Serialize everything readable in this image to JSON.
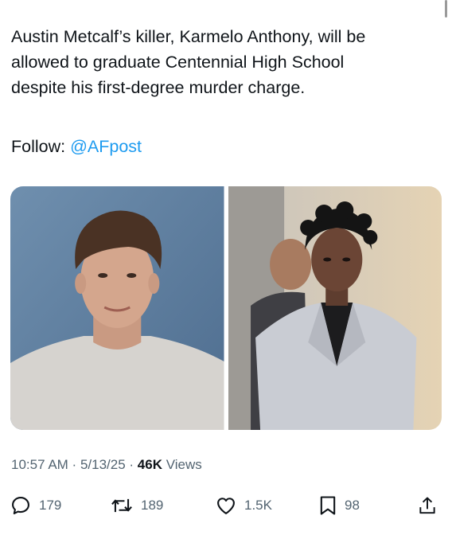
{
  "tweet": {
    "text": "Austin Metcalf’s killer, Karmelo Anthony, will be\nallowed to graduate Centennial High School\ndespite his first-degree murder charge.",
    "follow_label": "Follow:",
    "follow_handle": "@AFpost"
  },
  "meta": {
    "time": "10:57 AM",
    "sep1": " · ",
    "date": "5/13/25",
    "sep2": " · ",
    "views_count": "46K",
    "views_label": " Views"
  },
  "actions": {
    "replies": "179",
    "reposts": "189",
    "likes": "1.5K",
    "bookmarks": "98"
  },
  "icons": {
    "reply": "reply-icon",
    "repost": "repost-icon",
    "like": "heart-icon",
    "bookmark": "bookmark-icon",
    "share": "share-icon"
  },
  "colors": {
    "text": "#0f1419",
    "secondary": "#536471",
    "link": "#1d9bf0"
  }
}
